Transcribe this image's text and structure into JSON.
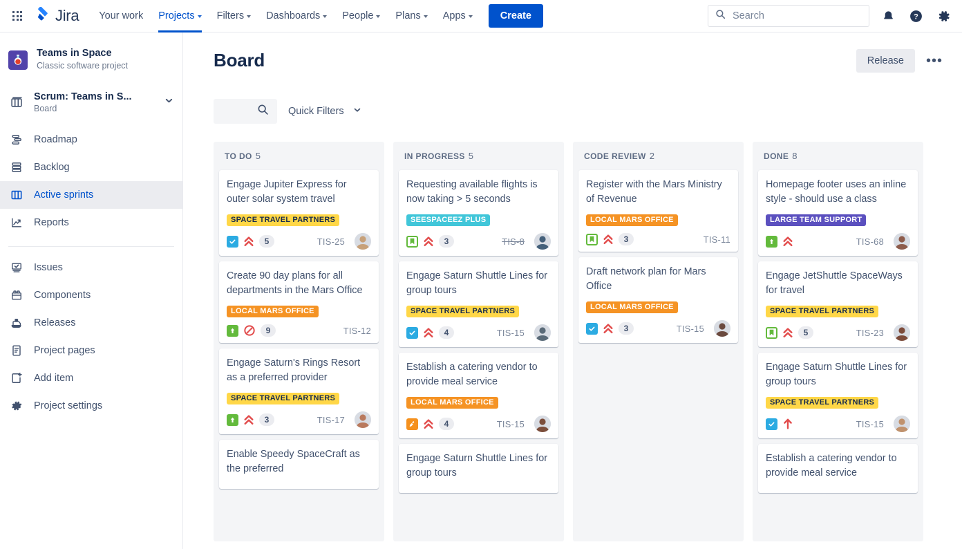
{
  "topnav": {
    "logo_text": "Jira",
    "items": [
      {
        "label": "Your work",
        "has_caret": false,
        "active": false
      },
      {
        "label": "Projects",
        "has_caret": true,
        "active": true
      },
      {
        "label": "Filters",
        "has_caret": true,
        "active": false
      },
      {
        "label": "Dashboards",
        "has_caret": true,
        "active": false
      },
      {
        "label": "People",
        "has_caret": true,
        "active": false
      },
      {
        "label": "Plans",
        "has_caret": true,
        "active": false
      },
      {
        "label": "Apps",
        "has_caret": true,
        "active": false
      }
    ],
    "create_label": "Create",
    "search_placeholder": "Search",
    "search_value": "",
    "icons": [
      "notifications-icon",
      "help-icon",
      "settings-icon"
    ]
  },
  "sidebar": {
    "project_name": "Teams in Space",
    "project_type": "Classic software project",
    "project_avatar_icon": "flask-icon",
    "board_name": "Scrum: Teams in S...",
    "board_sub": "Board",
    "items": [
      {
        "label": "Roadmap",
        "icon": "roadmap-icon",
        "selected": false
      },
      {
        "label": "Backlog",
        "icon": "backlog-icon",
        "selected": false
      },
      {
        "label": "Active sprints",
        "icon": "board-icon",
        "selected": true
      },
      {
        "label": "Reports",
        "icon": "reports-icon",
        "selected": false
      }
    ],
    "items2": [
      {
        "label": "Issues",
        "icon": "issues-icon",
        "selected": false
      },
      {
        "label": "Components",
        "icon": "components-icon",
        "selected": false
      },
      {
        "label": "Releases",
        "icon": "releases-icon",
        "selected": false
      },
      {
        "label": "Project pages",
        "icon": "pages-icon",
        "selected": false
      },
      {
        "label": "Add item",
        "icon": "add-item-icon",
        "selected": false
      },
      {
        "label": "Project settings",
        "icon": "gear-icon",
        "selected": false
      }
    ]
  },
  "main": {
    "page_title": "Board",
    "release_label": "Release",
    "more_label": "•••",
    "board_search_placeholder": "",
    "board_search_value": "",
    "quick_filters_label": "Quick Filters"
  },
  "colors": {
    "brand_blue": "#0052cc",
    "label_space_travel": "#ffd747",
    "label_local_mars": "#f59324",
    "label_seespaceez": "#41c6d9",
    "label_large_team": "#5b50bf",
    "type_task": "#2cabe2",
    "type_story": "#63ba3c",
    "type_bug": "#f5911e",
    "priority_high": "#e24c4c",
    "column_bg": "#f4f5f7"
  },
  "columns": [
    {
      "name": "TO DO",
      "count": "5",
      "cards": [
        {
          "title": "Engage Jupiter Express for outer solar system travel",
          "label": "SPACE TRAVEL PARTNERS",
          "label_class": "lbl-space",
          "type": "task",
          "priority": "highest",
          "points": "5",
          "key": "TIS-25",
          "resolved": false,
          "avatar": true,
          "avatar_color": "#c7a17a"
        },
        {
          "title": "Create 90 day plans for all departments in the Mars Office",
          "label": "LOCAL MARS OFFICE",
          "label_class": "lbl-mars",
          "type": "story",
          "priority": "blocker",
          "points": "9",
          "key": "TIS-12",
          "resolved": false,
          "avatar": false,
          "avatar_color": ""
        },
        {
          "title": "Engage Saturn's Rings Resort as a preferred provider",
          "label": "SPACE TRAVEL PARTNERS",
          "label_class": "lbl-space",
          "type": "story",
          "priority": "highest",
          "points": "3",
          "key": "TIS-17",
          "resolved": false,
          "avatar": true,
          "avatar_color": "#b97a5e"
        },
        {
          "title": "Enable Speedy SpaceCraft as the preferred",
          "label": "",
          "label_class": "",
          "type": "",
          "priority": "",
          "points": "",
          "key": "",
          "resolved": false,
          "avatar": false,
          "avatar_color": ""
        }
      ]
    },
    {
      "name": "IN PROGRESS",
      "count": "5",
      "cards": [
        {
          "title": "Requesting available flights is now taking > 5 seconds",
          "label": "SEESPACEEZ PLUS",
          "label_class": "lbl-sees",
          "type": "story-outline",
          "priority": "highest",
          "points": "3",
          "key": "TIS-8",
          "resolved": true,
          "avatar": true,
          "avatar_color": "#44607a"
        },
        {
          "title": "Engage Saturn Shuttle Lines for group tours",
          "label": "SPACE TRAVEL PARTNERS",
          "label_class": "lbl-space",
          "type": "task",
          "priority": "highest",
          "points": "4",
          "key": "TIS-15",
          "resolved": false,
          "avatar": true,
          "avatar_color": "#5a6a78"
        },
        {
          "title": "Establish a catering vendor to provide meal service",
          "label": "LOCAL MARS OFFICE",
          "label_class": "lbl-mars",
          "type": "bug",
          "priority": "highest",
          "points": "4",
          "key": "TIS-15",
          "resolved": false,
          "avatar": true,
          "avatar_color": "#7b4d3a"
        },
        {
          "title": "Engage Saturn Shuttle Lines for group tours",
          "label": "",
          "label_class": "",
          "type": "",
          "priority": "",
          "points": "",
          "key": "",
          "resolved": false,
          "avatar": false,
          "avatar_color": ""
        }
      ]
    },
    {
      "name": "CODE REVIEW",
      "count": "2",
      "cards": [
        {
          "title": "Register with the Mars Ministry of Revenue",
          "label": "LOCAL MARS OFFICE",
          "label_class": "lbl-mars",
          "type": "story-outline",
          "priority": "highest",
          "points": "3",
          "key": "TIS-11",
          "resolved": false,
          "avatar": false,
          "avatar_color": ""
        },
        {
          "title": "Draft network plan for Mars Office",
          "label": "LOCAL MARS OFFICE",
          "label_class": "lbl-mars",
          "type": "task",
          "priority": "highest",
          "points": "3",
          "key": "TIS-15",
          "resolved": false,
          "avatar": true,
          "avatar_color": "#6b4a3f"
        }
      ]
    },
    {
      "name": "DONE",
      "count": "8",
      "cards": [
        {
          "title": "Homepage footer uses an inline style - should use a class",
          "label": "LARGE TEAM SUPPORT",
          "label_class": "lbl-large",
          "type": "story",
          "priority": "highest",
          "points": "",
          "key": "TIS-68",
          "resolved": false,
          "avatar": true,
          "avatar_color": "#8d5c4c"
        },
        {
          "title": "Engage JetShuttle SpaceWays for travel",
          "label": "SPACE TRAVEL PARTNERS",
          "label_class": "lbl-space",
          "type": "story-outline",
          "priority": "highest",
          "points": "5",
          "key": "TIS-23",
          "resolved": false,
          "avatar": true,
          "avatar_color": "#7c4b3a"
        },
        {
          "title": "Engage Saturn Shuttle Lines for group tours",
          "label": "SPACE TRAVEL PARTNERS",
          "label_class": "lbl-space",
          "type": "task",
          "priority": "high",
          "points": "",
          "key": "TIS-15",
          "resolved": false,
          "avatar": true,
          "avatar_color": "#c0926d"
        },
        {
          "title": "Establish a catering vendor to provide meal service",
          "label": "",
          "label_class": "",
          "type": "",
          "priority": "",
          "points": "",
          "key": "",
          "resolved": false,
          "avatar": false,
          "avatar_color": ""
        }
      ]
    }
  ]
}
